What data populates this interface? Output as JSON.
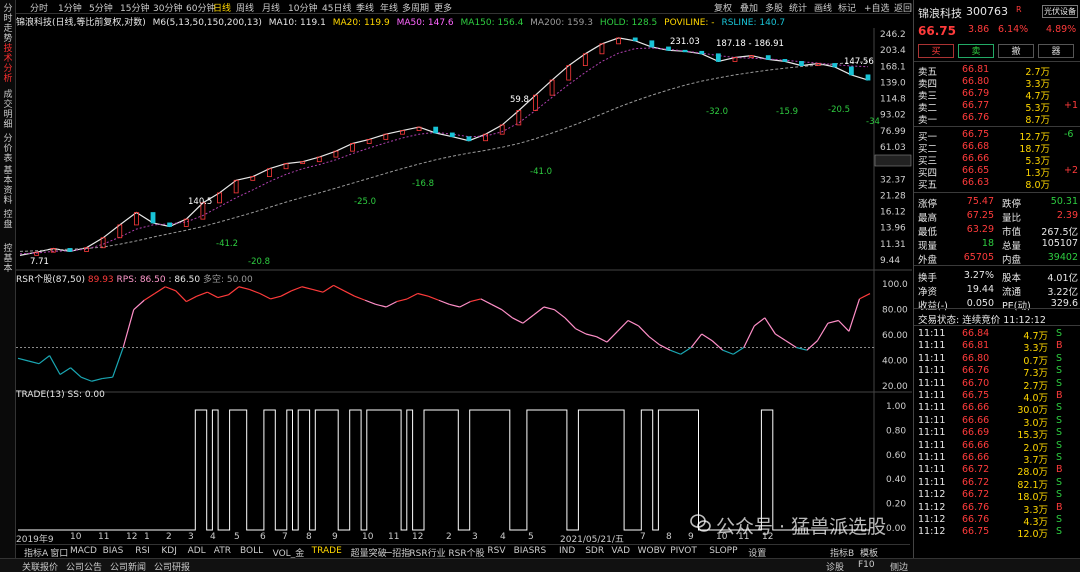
{
  "left_tabs": [
    "分时走势",
    "技术分析",
    "成交明细",
    "分价表",
    "基本资料",
    "控盘",
    "控基本"
  ],
  "left_tab_active": 1,
  "toolbar": {
    "periods": [
      "分时",
      "1分钟",
      "5分钟",
      "15分钟",
      "30分钟",
      "60分钟",
      "日线",
      "周线",
      "月线",
      "10分钟",
      "45日线",
      "季线",
      "年线",
      "多周期",
      "更多"
    ],
    "active_period": "日线",
    "right_buttons": [
      "复权",
      "叠加",
      "多股",
      "统计",
      "画线",
      "标记",
      "+自选",
      "返回"
    ]
  },
  "indicator_line": {
    "name": "锦浪科技(日线,等比前复权,对数)",
    "ma_title": "M6(5,13,50,150,200,13)",
    "ma10": "MA10: 119.1",
    "ma20": "MA20: 119.9",
    "ma50": "MA50: 147.6",
    "ma150": "MA150: 156.4",
    "ma200": "MA200: 159.3",
    "hold": "HOLD: 128.5",
    "poviline": "POVILINE: -",
    "rsline": "RSLINE: 140.7"
  },
  "price_axis": [
    "246.2",
    "203.4",
    "168.1",
    "139.0",
    "114.8",
    "93.02",
    "76.99",
    "61.03",
    "40.04",
    "32.37",
    "21.28",
    "16.12",
    "13.96",
    "11.31",
    "9.44"
  ],
  "price_annotations": [
    {
      "text": "140.5",
      "color": "#ffffff"
    },
    {
      "text": "-41.2",
      "color": "#2ecc40"
    },
    {
      "text": "-20.8",
      "color": "#2ecc40"
    },
    {
      "text": "-25.0",
      "color": "#2ecc40"
    },
    {
      "text": "-16.8",
      "color": "#2ecc40"
    },
    {
      "text": "-41.0",
      "color": "#2ecc40"
    },
    {
      "text": "-32.0",
      "color": "#2ecc40"
    },
    {
      "text": "-15.9",
      "color": "#2ecc40"
    },
    {
      "text": "-20.5",
      "color": "#2ecc40"
    },
    {
      "text": "-34",
      "color": "#2ecc40"
    },
    {
      "text": "59.8",
      "color": "#ffffff"
    },
    {
      "text": "231.03",
      "color": "#ffffff"
    },
    {
      "text": "187.18 - 186.91",
      "color": "#ffffff"
    },
    {
      "text": "147.56",
      "color": "#ffffff"
    },
    {
      "text": "7.71",
      "color": "#ffffff"
    }
  ],
  "chart_data": {
    "type": "line",
    "x_labels": [
      "2019年9",
      "10",
      "11",
      "12",
      "1",
      "2",
      "3",
      "4",
      "5",
      "6",
      "7",
      "8",
      "9",
      "10",
      "11",
      "12",
      "2",
      "3",
      "4",
      "5",
      "2021/05/21/五",
      "7",
      "8",
      "9",
      "10",
      "11",
      "12"
    ],
    "price_series": [
      {
        "name": "K线",
        "values": [
          8.0,
          8.4,
          8.9,
          8.5,
          9.0,
          10.5,
          12.8,
          15.5,
          13.2,
          12.5,
          14.0,
          18.0,
          21.0,
          25.5,
          27.0,
          30.5,
          33.0,
          34.0,
          36.5,
          40.0,
          45.0,
          48.0,
          52.0,
          55.0,
          58.0,
          53.0,
          50.0,
          47.0,
          52.0,
          60.0,
          75.0,
          95.0,
          120.0,
          150.0,
          180.0,
          210.0,
          230.0,
          220.0,
          200.0,
          190.0,
          187.0,
          180.0,
          160.0,
          170.0,
          175.0,
          165.0,
          160.0,
          150.0,
          155.0,
          147.0,
          130.0,
          120.0
        ]
      },
      {
        "name": "MA200",
        "values": [
          8.5,
          8.6,
          8.7,
          8.8,
          8.9,
          9.1,
          9.5,
          10.0,
          10.6,
          11.2,
          11.8,
          12.5,
          13.4,
          14.4,
          15.5,
          16.8,
          18.2,
          19.6,
          21.0,
          22.6,
          24.4,
          26.3,
          28.4,
          30.6,
          32.8,
          35.0,
          37.0,
          38.8,
          40.5,
          42.5,
          45.0,
          48.5,
          53.0,
          58.0,
          64.0,
          71.0,
          79.0,
          87.0,
          95.0,
          103.0,
          111.0,
          118.0,
          124.0,
          130.0,
          135.0,
          140.0,
          144.0,
          148.0,
          151.0,
          154.0,
          157.0,
          159.3
        ]
      },
      {
        "name": "MA50",
        "values": [
          8.2,
          8.3,
          8.5,
          8.6,
          8.8,
          9.5,
          10.6,
          12.0,
          12.8,
          13.0,
          13.4,
          14.8,
          17.0,
          19.5,
          22.0,
          25.0,
          28.0,
          30.5,
          32.5,
          35.0,
          38.5,
          42.0,
          45.5,
          49.0,
          52.0,
          53.5,
          52.0,
          50.0,
          50.5,
          54.0,
          62.0,
          75.0,
          92.0,
          112.0,
          135.0,
          160.0,
          182.0,
          195.0,
          197.0,
          193.0,
          188.0,
          182.0,
          175.0,
          170.0,
          168.0,
          166.0,
          163.0,
          159.0,
          156.0,
          152.0,
          149.0,
          147.6
        ]
      }
    ],
    "rsr": {
      "title": "RSR个股(87,50)",
      "value1": "89.93",
      "rps": "RPS: 86.50",
      "value2": ": 86.50",
      "duokong": "多空: 50.00",
      "axis": [
        "100.0",
        "80.00",
        "60.00",
        "40.00",
        "20.00"
      ],
      "ylim": [
        20,
        100
      ],
      "threshold": 50,
      "values": [
        42,
        40,
        38,
        44,
        30,
        35,
        28,
        25,
        27,
        28,
        50,
        78,
        85,
        90,
        95,
        92,
        84,
        88,
        91,
        87,
        89,
        95,
        93,
        90,
        86,
        88,
        92,
        95,
        93,
        91,
        96,
        92,
        88,
        85,
        82,
        80,
        84,
        86,
        90,
        88,
        85,
        82,
        80,
        84,
        86,
        82,
        78,
        72,
        68,
        74,
        80,
        78,
        72,
        64,
        60,
        58,
        54,
        62,
        70,
        66,
        58,
        52,
        48,
        45,
        50,
        60,
        55,
        48,
        45,
        50,
        66,
        72,
        60,
        55,
        50,
        48,
        55,
        68,
        70,
        62,
        86,
        89.93
      ]
    },
    "trade": {
      "title": "TRADE(13)",
      "ss": "SS: 0.00",
      "axis": [
        "1.00",
        "0.80",
        "0.60",
        "0.40",
        "0.20",
        "0.00"
      ],
      "ylim": [
        0,
        1
      ],
      "values": [
        0,
        0,
        0,
        0,
        0,
        0,
        0,
        0,
        0,
        0,
        0,
        0,
        0,
        0,
        0,
        0,
        0,
        0,
        0,
        0,
        0,
        0,
        0,
        0,
        0,
        0,
        0,
        0,
        0,
        0,
        0,
        1,
        1,
        0,
        1,
        0,
        0,
        1,
        1,
        1,
        0,
        0,
        0,
        1,
        1,
        0,
        0,
        1,
        0,
        1,
        1,
        0,
        1,
        1,
        1,
        1,
        0,
        0,
        1,
        1,
        0,
        1,
        1,
        1,
        1,
        1,
        1,
        0,
        1,
        0,
        0,
        1,
        1,
        1,
        1,
        1,
        1,
        0,
        0,
        1,
        1,
        1,
        1,
        1,
        1,
        1,
        0,
        0,
        0,
        1,
        1,
        1,
        1,
        1,
        1,
        1,
        0,
        0,
        1,
        1,
        1,
        1,
        1,
        1,
        1,
        1,
        0,
        0,
        0,
        1,
        1,
        0,
        1,
        1,
        1,
        1,
        1,
        1,
        1,
        0,
        0,
        0,
        0,
        0,
        0,
        0,
        0,
        0,
        0,
        0,
        1,
        1,
        0,
        0,
        0,
        0,
        0,
        0,
        0,
        0,
        0,
        0,
        0,
        0,
        0,
        0,
        0,
        0,
        0,
        0
      ]
    }
  },
  "bottom_tabs": [
    "指标A",
    "窗口",
    "MACD",
    "BIAS",
    "RSI",
    "KDJ",
    "ADL",
    "ATR",
    "BOLL",
    "VOL_金",
    "TRADE",
    "超量突破",
    "一招指",
    "RSR行业",
    "RSR个股",
    "RSV",
    "BIASRS",
    "IND",
    "SDR",
    "VAD",
    "WOBV",
    "PIVOT",
    "SLOPP",
    "设置"
  ],
  "bottom_tab_active": "TRADE",
  "bottom_right": [
    "指标B",
    "模板"
  ],
  "status_bar": {
    "items": [
      "关联报价",
      "公司公告",
      "公司新闻",
      "公司研报"
    ],
    "right": [
      "诊股",
      "F10",
      "侧边"
    ]
  },
  "watermark": "公众号 · 猛兽派选股",
  "stock": {
    "name": "锦浪科技",
    "code": "300763",
    "badge": "R",
    "price": "66.75",
    "change": "3.86",
    "pct": "6.14%",
    "industry": "光伏设备",
    "industry_pct": "4.89%",
    "buttons": [
      "买",
      "卖",
      "撤",
      "器"
    ],
    "asks": [
      {
        "label": "卖五",
        "price": "66.81",
        "vol": "2.7万",
        "chg": ""
      },
      {
        "label": "卖四",
        "price": "66.80",
        "vol": "3.3万",
        "chg": ""
      },
      {
        "label": "卖三",
        "price": "66.79",
        "vol": "4.7万",
        "chg": ""
      },
      {
        "label": "卖二",
        "price": "66.77",
        "vol": "5.3万",
        "chg": "+1"
      },
      {
        "label": "卖一",
        "price": "66.76",
        "vol": "8.7万",
        "chg": ""
      }
    ],
    "bids": [
      {
        "label": "买一",
        "price": "66.75",
        "vol": "12.7万",
        "chg": "-6"
      },
      {
        "label": "买二",
        "price": "66.68",
        "vol": "18.7万",
        "chg": ""
      },
      {
        "label": "买三",
        "price": "66.66",
        "vol": "5.3万",
        "chg": ""
      },
      {
        "label": "买四",
        "price": "66.65",
        "vol": "1.3万",
        "chg": "+2"
      },
      {
        "label": "买五",
        "price": "66.63",
        "vol": "8.0万",
        "chg": ""
      }
    ],
    "stats": [
      {
        "k1": "涨停",
        "v1": "75.47",
        "c1": "red",
        "k2": "跌停",
        "v2": "50.31",
        "c2": "green"
      },
      {
        "k1": "最高",
        "v1": "67.25",
        "c1": "red",
        "k2": "量比",
        "v2": "2.39",
        "c2": "red"
      },
      {
        "k1": "最低",
        "v1": "63.29",
        "c1": "red",
        "k2": "市值",
        "v2": "267.5亿",
        "c2": "white"
      },
      {
        "k1": "现量",
        "v1": "18",
        "c1": "green",
        "k2": "总量",
        "v2": "105107",
        "c2": "white"
      },
      {
        "k1": "外盘",
        "v1": "65705",
        "c1": "red",
        "k2": "内盘",
        "v2": "39402",
        "c2": "green"
      },
      {
        "k1": "换手",
        "v1": "3.27%",
        "c1": "white",
        "k2": "股本",
        "v2": "4.01亿",
        "c2": "white"
      },
      {
        "k1": "净资",
        "v1": "19.44",
        "c1": "white",
        "k2": "流通",
        "v2": "3.22亿",
        "c2": "white"
      },
      {
        "k1": "收益(-)",
        "v1": "0.050",
        "c1": "white",
        "k2": "PE(动)",
        "v2": "329.6",
        "c2": "white"
      }
    ],
    "trade_state": "交易状态: 连续竞价 11:12:12",
    "ticks": [
      {
        "t": "11:11",
        "p": "66.84",
        "v": "4.7万",
        "s": "S"
      },
      {
        "t": "11:11",
        "p": "66.81",
        "v": "3.3万",
        "s": "B"
      },
      {
        "t": "11:11",
        "p": "66.80",
        "v": "0.7万",
        "s": "S"
      },
      {
        "t": "11:11",
        "p": "66.76",
        "v": "7.3万",
        "s": "S"
      },
      {
        "t": "11:11",
        "p": "66.70",
        "v": "2.7万",
        "s": "S"
      },
      {
        "t": "11:11",
        "p": "66.75",
        "v": "4.0万",
        "s": "B"
      },
      {
        "t": "11:11",
        "p": "66.66",
        "v": "30.0万",
        "s": "S"
      },
      {
        "t": "11:11",
        "p": "66.66",
        "v": "3.0万",
        "s": "S"
      },
      {
        "t": "11:11",
        "p": "66.69",
        "v": "15.3万",
        "s": "S"
      },
      {
        "t": "11:11",
        "p": "66.66",
        "v": "2.0万",
        "s": "S"
      },
      {
        "t": "11:11",
        "p": "66.66",
        "v": "3.7万",
        "s": "S"
      },
      {
        "t": "11:11",
        "p": "66.72",
        "v": "28.0万",
        "s": "B"
      },
      {
        "t": "11:11",
        "p": "66.72",
        "v": "82.1万",
        "s": "S"
      },
      {
        "t": "11:12",
        "p": "66.72",
        "v": "18.0万",
        "s": "S"
      },
      {
        "t": "11:12",
        "p": "66.76",
        "v": "3.3万",
        "s": "B"
      },
      {
        "t": "11:12",
        "p": "66.76",
        "v": "4.3万",
        "s": "S"
      },
      {
        "t": "11:12",
        "p": "66.75",
        "v": "12.0万",
        "s": "S"
      }
    ]
  }
}
